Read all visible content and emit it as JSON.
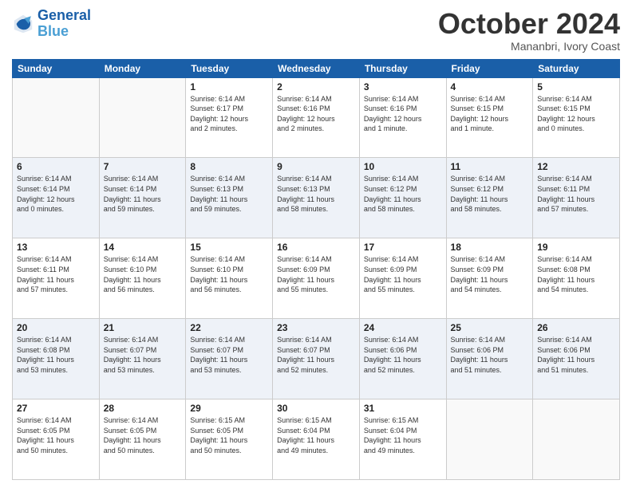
{
  "header": {
    "logo_line1": "General",
    "logo_line2": "Blue",
    "month": "October 2024",
    "location": "Mananbri, Ivory Coast"
  },
  "days_of_week": [
    "Sunday",
    "Monday",
    "Tuesday",
    "Wednesday",
    "Thursday",
    "Friday",
    "Saturday"
  ],
  "weeks": [
    [
      {
        "day": "",
        "info": ""
      },
      {
        "day": "",
        "info": ""
      },
      {
        "day": "1",
        "info": "Sunrise: 6:14 AM\nSunset: 6:17 PM\nDaylight: 12 hours\nand 2 minutes."
      },
      {
        "day": "2",
        "info": "Sunrise: 6:14 AM\nSunset: 6:16 PM\nDaylight: 12 hours\nand 2 minutes."
      },
      {
        "day": "3",
        "info": "Sunrise: 6:14 AM\nSunset: 6:16 PM\nDaylight: 12 hours\nand 1 minute."
      },
      {
        "day": "4",
        "info": "Sunrise: 6:14 AM\nSunset: 6:15 PM\nDaylight: 12 hours\nand 1 minute."
      },
      {
        "day": "5",
        "info": "Sunrise: 6:14 AM\nSunset: 6:15 PM\nDaylight: 12 hours\nand 0 minutes."
      }
    ],
    [
      {
        "day": "6",
        "info": "Sunrise: 6:14 AM\nSunset: 6:14 PM\nDaylight: 12 hours\nand 0 minutes."
      },
      {
        "day": "7",
        "info": "Sunrise: 6:14 AM\nSunset: 6:14 PM\nDaylight: 11 hours\nand 59 minutes."
      },
      {
        "day": "8",
        "info": "Sunrise: 6:14 AM\nSunset: 6:13 PM\nDaylight: 11 hours\nand 59 minutes."
      },
      {
        "day": "9",
        "info": "Sunrise: 6:14 AM\nSunset: 6:13 PM\nDaylight: 11 hours\nand 58 minutes."
      },
      {
        "day": "10",
        "info": "Sunrise: 6:14 AM\nSunset: 6:12 PM\nDaylight: 11 hours\nand 58 minutes."
      },
      {
        "day": "11",
        "info": "Sunrise: 6:14 AM\nSunset: 6:12 PM\nDaylight: 11 hours\nand 58 minutes."
      },
      {
        "day": "12",
        "info": "Sunrise: 6:14 AM\nSunset: 6:11 PM\nDaylight: 11 hours\nand 57 minutes."
      }
    ],
    [
      {
        "day": "13",
        "info": "Sunrise: 6:14 AM\nSunset: 6:11 PM\nDaylight: 11 hours\nand 57 minutes."
      },
      {
        "day": "14",
        "info": "Sunrise: 6:14 AM\nSunset: 6:10 PM\nDaylight: 11 hours\nand 56 minutes."
      },
      {
        "day": "15",
        "info": "Sunrise: 6:14 AM\nSunset: 6:10 PM\nDaylight: 11 hours\nand 56 minutes."
      },
      {
        "day": "16",
        "info": "Sunrise: 6:14 AM\nSunset: 6:09 PM\nDaylight: 11 hours\nand 55 minutes."
      },
      {
        "day": "17",
        "info": "Sunrise: 6:14 AM\nSunset: 6:09 PM\nDaylight: 11 hours\nand 55 minutes."
      },
      {
        "day": "18",
        "info": "Sunrise: 6:14 AM\nSunset: 6:09 PM\nDaylight: 11 hours\nand 54 minutes."
      },
      {
        "day": "19",
        "info": "Sunrise: 6:14 AM\nSunset: 6:08 PM\nDaylight: 11 hours\nand 54 minutes."
      }
    ],
    [
      {
        "day": "20",
        "info": "Sunrise: 6:14 AM\nSunset: 6:08 PM\nDaylight: 11 hours\nand 53 minutes."
      },
      {
        "day": "21",
        "info": "Sunrise: 6:14 AM\nSunset: 6:07 PM\nDaylight: 11 hours\nand 53 minutes."
      },
      {
        "day": "22",
        "info": "Sunrise: 6:14 AM\nSunset: 6:07 PM\nDaylight: 11 hours\nand 53 minutes."
      },
      {
        "day": "23",
        "info": "Sunrise: 6:14 AM\nSunset: 6:07 PM\nDaylight: 11 hours\nand 52 minutes."
      },
      {
        "day": "24",
        "info": "Sunrise: 6:14 AM\nSunset: 6:06 PM\nDaylight: 11 hours\nand 52 minutes."
      },
      {
        "day": "25",
        "info": "Sunrise: 6:14 AM\nSunset: 6:06 PM\nDaylight: 11 hours\nand 51 minutes."
      },
      {
        "day": "26",
        "info": "Sunrise: 6:14 AM\nSunset: 6:06 PM\nDaylight: 11 hours\nand 51 minutes."
      }
    ],
    [
      {
        "day": "27",
        "info": "Sunrise: 6:14 AM\nSunset: 6:05 PM\nDaylight: 11 hours\nand 50 minutes."
      },
      {
        "day": "28",
        "info": "Sunrise: 6:14 AM\nSunset: 6:05 PM\nDaylight: 11 hours\nand 50 minutes."
      },
      {
        "day": "29",
        "info": "Sunrise: 6:15 AM\nSunset: 6:05 PM\nDaylight: 11 hours\nand 50 minutes."
      },
      {
        "day": "30",
        "info": "Sunrise: 6:15 AM\nSunset: 6:04 PM\nDaylight: 11 hours\nand 49 minutes."
      },
      {
        "day": "31",
        "info": "Sunrise: 6:15 AM\nSunset: 6:04 PM\nDaylight: 11 hours\nand 49 minutes."
      },
      {
        "day": "",
        "info": ""
      },
      {
        "day": "",
        "info": ""
      }
    ]
  ]
}
